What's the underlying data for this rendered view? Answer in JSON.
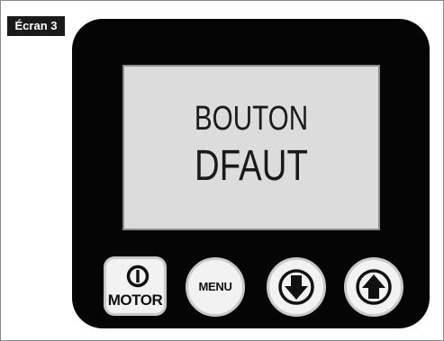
{
  "screen_label": "Écran 3",
  "display": {
    "line1": "BOUTON",
    "line2": "DFAUT"
  },
  "buttons": {
    "motor": {
      "label": "MOTOR",
      "icon": "power-icon"
    },
    "menu": {
      "label": "MENU"
    },
    "down": {
      "icon": "arrow-down-icon"
    },
    "up": {
      "icon": "arrow-up-icon"
    }
  },
  "colors": {
    "device_body": "#050505",
    "lcd_background": "#dcdcdc",
    "button_face": "#f2f2f2",
    "label_tag": "#1a1a1a"
  }
}
